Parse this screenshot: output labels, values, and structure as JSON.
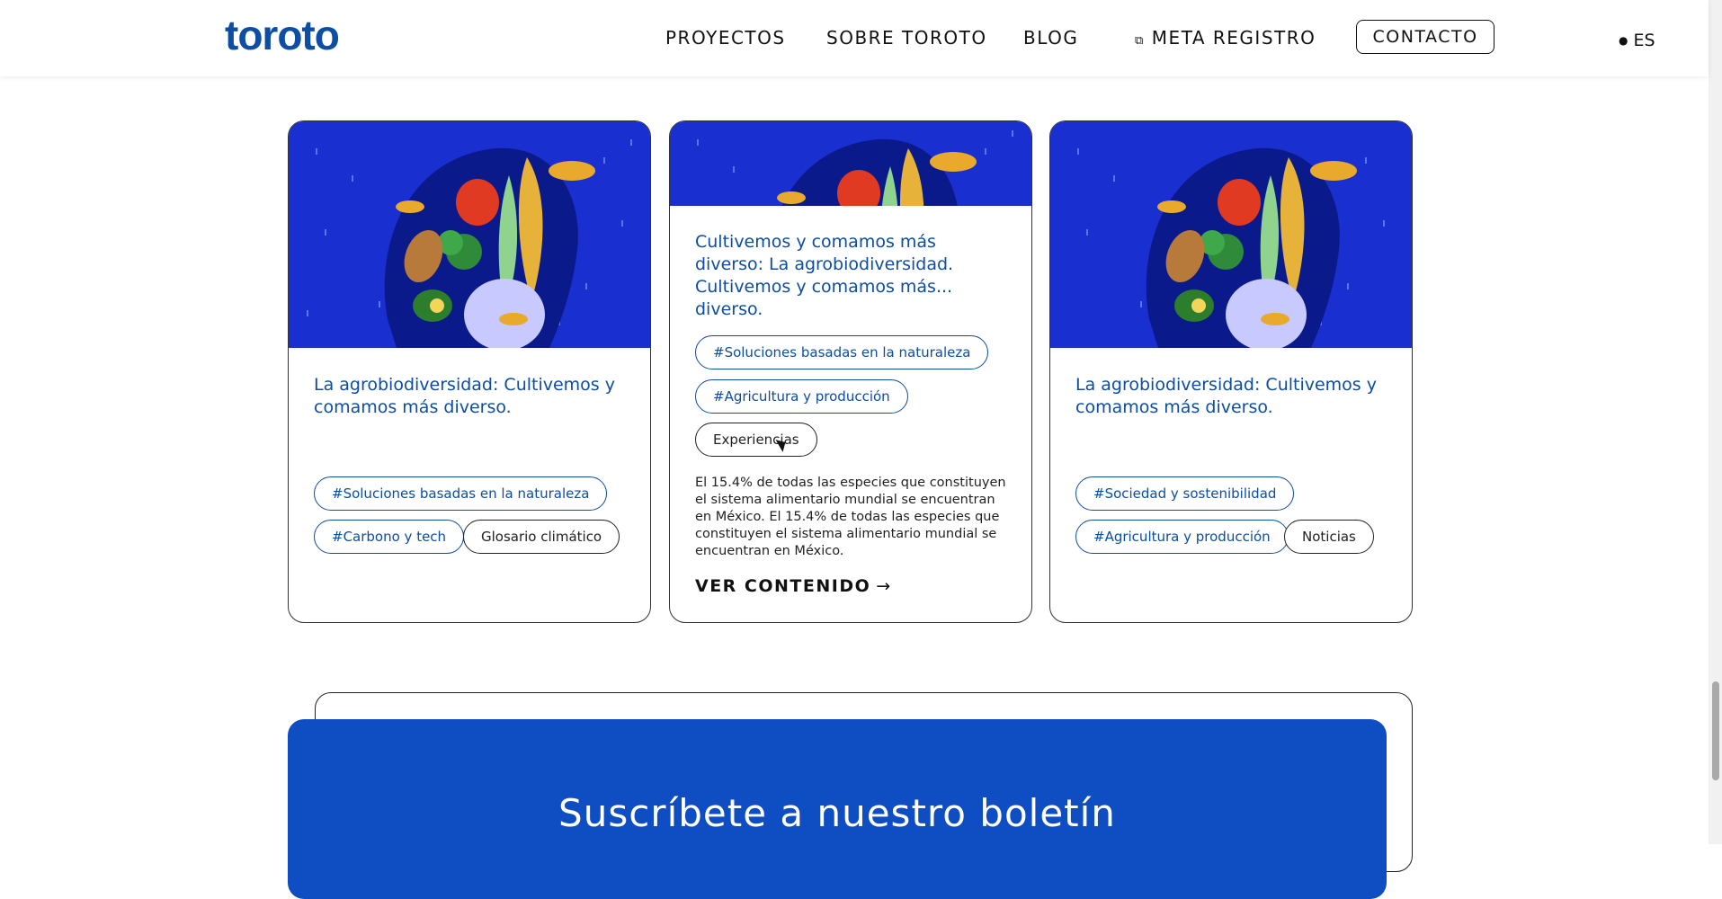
{
  "header": {
    "logo": "toroto",
    "nav": [
      "PROYECTOS",
      "SOBRE TOROTO",
      "BLOG"
    ],
    "meta_registro": "META REGISTRO",
    "contact": "CONTACTO",
    "lang": "ES"
  },
  "cards": [
    {
      "title": "La agrobiodiversidad: Cultivemos y comamos más diverso.",
      "tags": [
        "#Soluciones basadas en la naturaleza",
        "#Carbono y tech",
        "Glosario climático"
      ]
    },
    {
      "title": "Cultivemos y comamos más diverso: La agrobiodiversidad. Cultivemos y comamos más... diverso.",
      "tags": [
        "#Soluciones basadas en la naturaleza",
        "#Agricultura y producción",
        "Experiencias"
      ],
      "description": "El 15.4% de todas las especies que constituyen el sistema alimentario mundial se encuentran en México. El 15.4% de todas las especies que constituyen el sistema alimentario mundial se encuentran en México.",
      "link": "VER CONTENIDO",
      "arrow": "→"
    },
    {
      "title": "La agrobiodiversidad: Cultivemos y comamos más diverso.",
      "tags": [
        "#Sociedad y sostenibilidad",
        "#Agricultura y producción",
        "Noticias"
      ]
    }
  ],
  "newsletter": {
    "title": "Suscríbete a nuestro boletín"
  },
  "colors": {
    "brand": "#0e4da4",
    "image_bg": "#1a2fd0",
    "newsletter_bg": "#0e4ec2"
  }
}
